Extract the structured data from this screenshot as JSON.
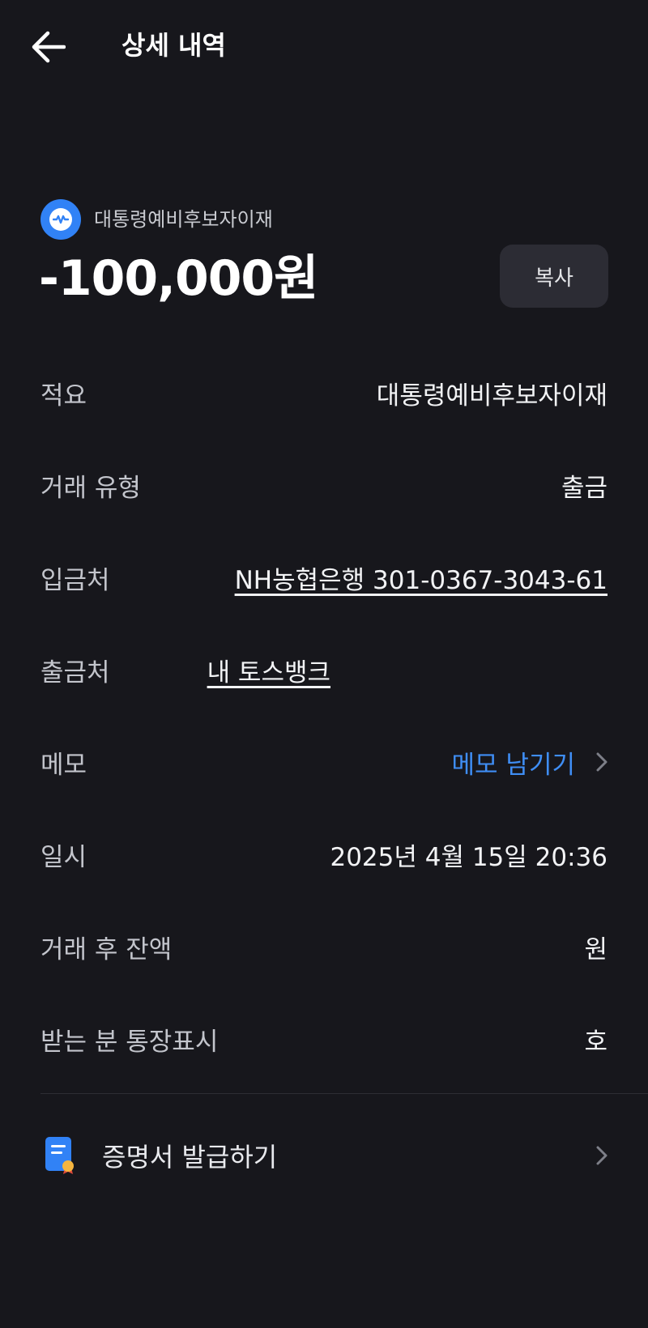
{
  "header": {
    "title": "상세 내역"
  },
  "merchant": {
    "name": "대통령예비후보자이재"
  },
  "amount": "-100,000원",
  "copy_label": "복사",
  "rows": {
    "memo_title": {
      "label": "적요",
      "value": "대통령예비후보자이재"
    },
    "type": {
      "label": "거래 유형",
      "value": "출금"
    },
    "to": {
      "label": "입금처",
      "value": "NH농협은행 301-0367-3043-61"
    },
    "from": {
      "label": "출금처",
      "value": "내 토스뱅크"
    },
    "memo": {
      "label": "메모",
      "value": "메모 남기기"
    },
    "datetime": {
      "label": "일시",
      "value": "2025년 4월 15일 20:36"
    },
    "balance": {
      "label": "거래 후 잔액",
      "value": "원"
    },
    "display": {
      "label": "받는 분 통장표시",
      "value": "호"
    }
  },
  "certificate": {
    "label": "증명서 발급하기"
  },
  "colors": {
    "background": "#17171c",
    "accent": "#3182f6",
    "link_blue": "#3f8ef5"
  }
}
